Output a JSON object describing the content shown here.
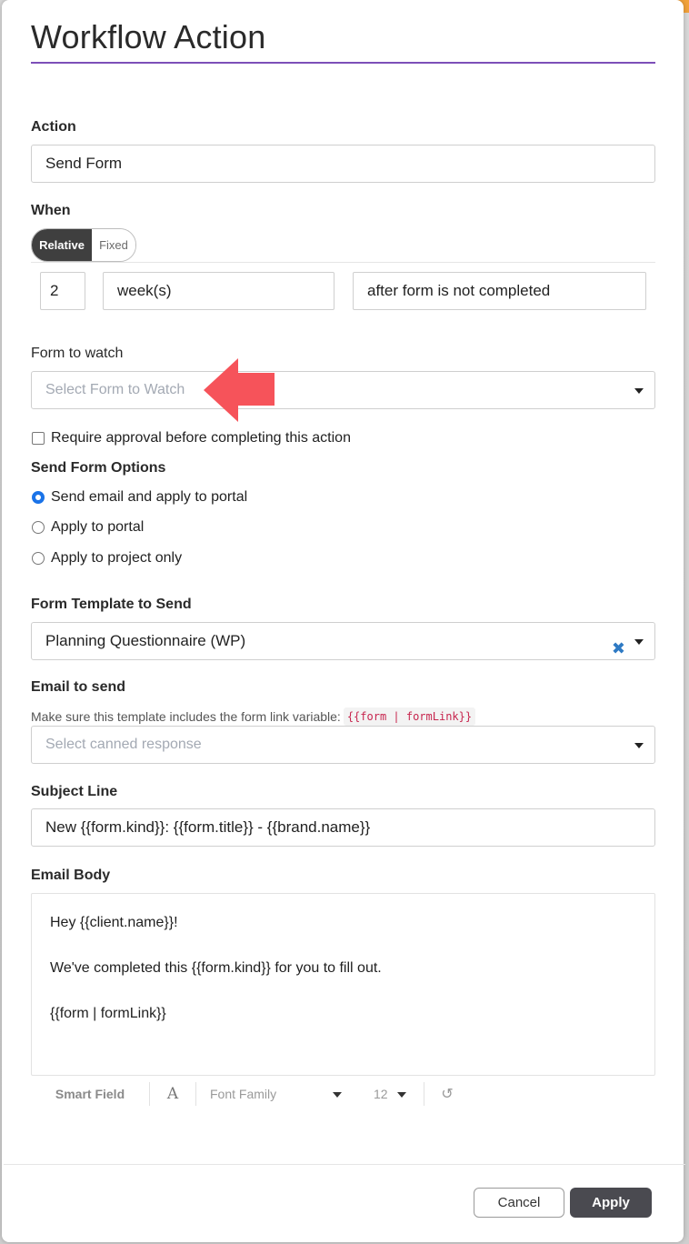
{
  "modal": {
    "title": "Workflow Action"
  },
  "action": {
    "label": "Action",
    "value": "Send Form"
  },
  "when": {
    "label": "When",
    "toggle_relative": "Relative",
    "toggle_fixed": "Fixed",
    "amount": "2",
    "unit": "week(s)",
    "condition": "after form is not completed"
  },
  "form_to_watch": {
    "label": "Form to watch",
    "placeholder": "Select Form to Watch"
  },
  "require_approval": {
    "label": "Require approval before completing this action",
    "checked": false
  },
  "send_form_options": {
    "label": "Send Form Options",
    "options": [
      {
        "label": "Send email and apply to portal",
        "checked": true
      },
      {
        "label": "Apply to portal",
        "checked": false
      },
      {
        "label": "Apply to project only",
        "checked": false
      }
    ]
  },
  "form_template": {
    "label": "Form Template to Send",
    "value": "Planning Questionnaire (WP)"
  },
  "email_to_send": {
    "label": "Email to send",
    "hint": "Make sure this template includes the form link variable:",
    "hint_code": "{{form | formLink}}",
    "placeholder": "Select canned response"
  },
  "subject_line": {
    "label": "Subject Line",
    "value": "New {{form.kind}}: {{form.title}} - {{brand.name}}"
  },
  "email_body": {
    "label": "Email Body",
    "lines": [
      "Hey {{client.name}}!",
      "We've completed this {{form.kind}} for you to fill out.",
      "{{form | formLink}}"
    ]
  },
  "toolbar": {
    "smart_field": "Smart Field",
    "font_family": "Font Family",
    "font_size": "12"
  },
  "footer": {
    "cancel_label": "Cancel",
    "apply_label": "Apply"
  },
  "colors": {
    "title_rule": "#7d4fb8",
    "arrow": "#f6535a",
    "clear_icon": "#2e7ac4",
    "apply_button": "#4a4a50"
  },
  "icons": {
    "arrow": "left-arrow-annotation",
    "clear": "clear-x-icon",
    "dropdown": "chevron-down-icon",
    "font": "font-icon",
    "undo": "undo-icon"
  }
}
